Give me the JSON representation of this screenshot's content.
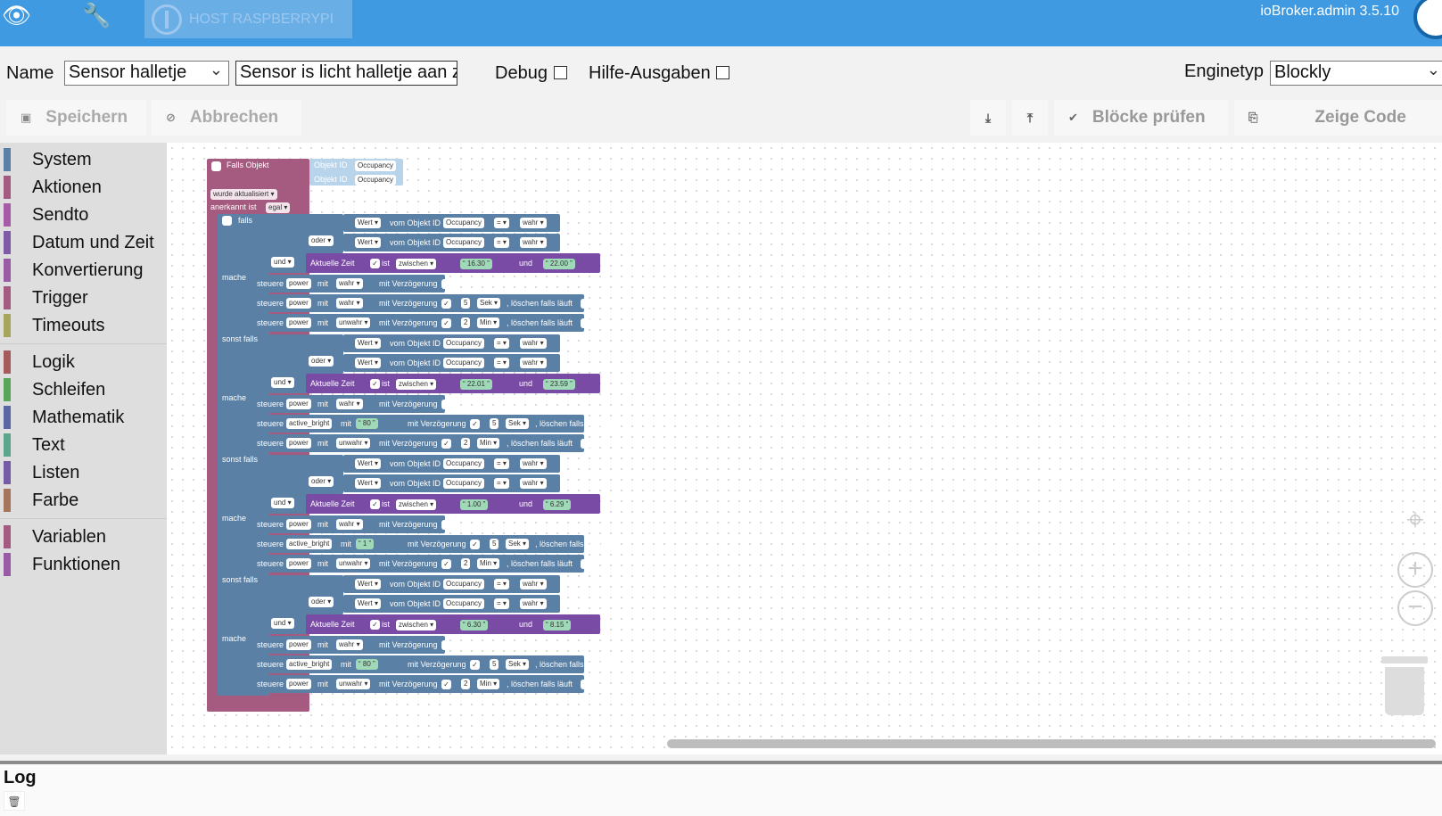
{
  "topbar": {
    "host_tab_label": "HOST RASPBERRYPI",
    "brand": "ioBroker.admin 3.5.10"
  },
  "toolbar": {
    "name_label": "Name",
    "name_value": "Sensor halletje",
    "description_value": "Sensor is licht halletje aan z",
    "debug_label": "Debug",
    "help_label": "Hilfe-Ausgaben",
    "engine_label": "Enginetyp",
    "engine_value": "Blockly",
    "save_label": "Speichern",
    "cancel_label": "Abbrechen",
    "check_label": "Blöcke prüfen",
    "code_label": "Zeige Code"
  },
  "sidebar": {
    "groups": [
      [
        {
          "label": "System",
          "color": "#5b80a5"
        },
        {
          "label": "Aktionen",
          "color": "#a55b80"
        },
        {
          "label": "Sendto",
          "color": "#a55ba5"
        },
        {
          "label": "Datum und Zeit",
          "color": "#805ba5"
        },
        {
          "label": "Konvertierung",
          "color": "#9a5ba5"
        },
        {
          "label": "Trigger",
          "color": "#a55b80"
        },
        {
          "label": "Timeouts",
          "color": "#a5a55b"
        }
      ],
      [
        {
          "label": "Logik",
          "color": "#a55b5b"
        },
        {
          "label": "Schleifen",
          "color": "#5ba55b"
        },
        {
          "label": "Mathematik",
          "color": "#5b67a5"
        },
        {
          "label": "Text",
          "color": "#5ba58c"
        },
        {
          "label": "Listen",
          "color": "#745ba5"
        },
        {
          "label": "Farbe",
          "color": "#a5745b"
        }
      ],
      [
        {
          "label": "Variablen",
          "color": "#a55b80"
        },
        {
          "label": "Funktionen",
          "color": "#995ba5"
        }
      ]
    ]
  },
  "blockly": {
    "trigger": "Falls Objekt",
    "objekt_id": "Objekt ID",
    "occupancy": "Occupancy",
    "wurde_aktualisiert": "wurde aktualisiert",
    "anerkannt_ist": "anerkannt ist",
    "egal": "egal",
    "falls": "falls",
    "mache": "mache",
    "sonst_falls": "sonst falls",
    "und": "und",
    "oder": "oder",
    "wert": "Wert",
    "vom_objekt_id": "vom Objekt ID",
    "eq": "=",
    "wahr": "wahr",
    "unwahr": "unwahr",
    "aktuelle_zeit": "Aktuelle Zeit",
    "ist": "ist",
    "zwischen": "zwischen",
    "steuere": "steuere",
    "mit": "mit",
    "mit_verzoegerung": "mit Verzögerung",
    "loeschen": ", löschen falls läuft",
    "sek": "Sek",
    "min": "Min",
    "power": "power",
    "active_bright": "active_bright",
    "branches": [
      {
        "from": "16.30",
        "to": "22.00",
        "bright": null,
        "delay1": "5",
        "delay2": "2"
      },
      {
        "from": "22.01",
        "to": "23.59",
        "bright": "80",
        "delay1": "5",
        "delay2": "2"
      },
      {
        "from": "1.00",
        "to": "6.29",
        "bright": "1",
        "delay1": "5",
        "delay2": "2"
      },
      {
        "from": "6.30",
        "to": "8.15",
        "bright": "80",
        "delay1": "5",
        "delay2": "2"
      }
    ]
  },
  "log": {
    "title": "Log"
  }
}
